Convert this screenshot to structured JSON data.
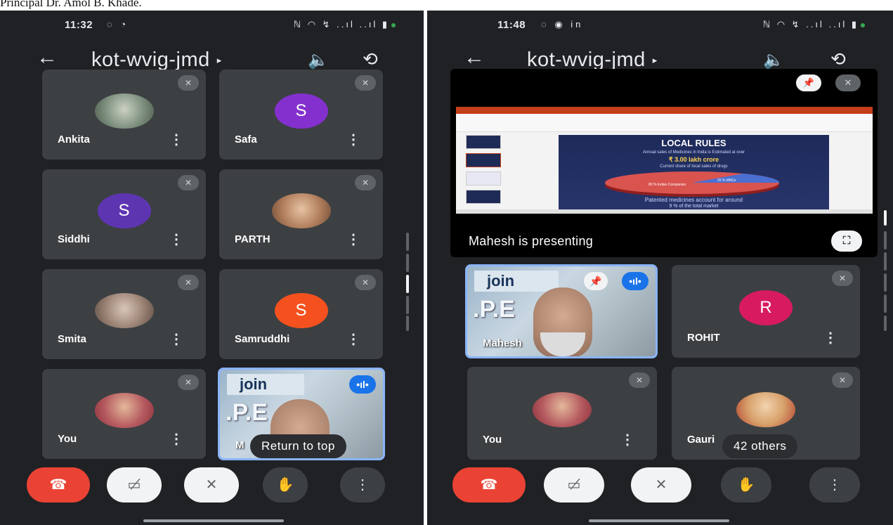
{
  "caption": "Principal Dr. Amol B. Khade.",
  "left": {
    "status": {
      "time": "11:32",
      "time_icons": "◌ ◔",
      "sys": "ℕ ◠ ↯ ..ıl ..ıl ▮"
    },
    "header": {
      "title": "kot-wvig-jmd",
      "caret": "▸",
      "back": "←",
      "speaker": "🔈",
      "camera": "⟲"
    },
    "tiles": [
      {
        "name": "Ankita",
        "kind": "photo",
        "color": "#8a9f8c"
      },
      {
        "name": "Safa",
        "kind": "letter",
        "letter": "S",
        "color": "#8430ce"
      },
      {
        "name": "Siddhi",
        "kind": "letter",
        "letter": "S",
        "color": "#5e35b1"
      },
      {
        "name": "PARTH",
        "kind": "photo",
        "color": "#c58e6f"
      },
      {
        "name": "Smita",
        "kind": "photo",
        "color": "#a08a7f"
      },
      {
        "name": "Samruddhi",
        "kind": "letter",
        "letter": "S",
        "color": "#f4511e"
      },
      {
        "name": "You",
        "kind": "photo",
        "color": "#c44a5a"
      }
    ],
    "video": {
      "banner": "join",
      "pe": ".P.E",
      "name": "M",
      "speaking": "•ıl•"
    },
    "return_chip": "Return to top"
  },
  "right": {
    "status": {
      "time": "11:48",
      "time_icons": "◌ ◉ in",
      "sys": "ℕ ◠ ↯ ..ıl ..ıl ▮"
    },
    "header": {
      "title": "kot-wvig-jmd",
      "caret": "▸",
      "back": "←",
      "speaker": "🔈",
      "camera": "⟲"
    },
    "presenting": {
      "label": "Mahesh is presenting",
      "pin": "📌",
      "mic": "✕",
      "fullscreen": "⛶",
      "slide": {
        "heading": "LOCAL RULES",
        "line1": "Annual sales of Medicines in India is Estimated at over",
        "line2": "₹ 3.00 lakh crore",
        "line3": "Current share of local sales of drugs",
        "label_mnc": "20 % MNCs",
        "label_indian": "80 % Indian Companies",
        "bottom1": "Patented medicines account for around",
        "bottom2": "9 % of the total market"
      }
    },
    "video": {
      "banner": "join",
      "pe": ".P.E",
      "name": "Mahesh",
      "speaking": "•ıl•",
      "pin": "📌"
    },
    "tiles": [
      {
        "name": "ROHIT",
        "kind": "letter",
        "letter": "R",
        "color": "#d81b60"
      },
      {
        "name": "You",
        "kind": "photo",
        "color": "#c44a5a"
      },
      {
        "name": "Gauri",
        "kind": "photo",
        "color": "#d7a16a"
      }
    ],
    "others_chip": "42 others"
  },
  "controls": {
    "end": "☎",
    "camera": "▭̸",
    "mic": "✕",
    "hand": "✋",
    "more": "⋮"
  },
  "mic_off": "✕",
  "more_icon": "⋮"
}
